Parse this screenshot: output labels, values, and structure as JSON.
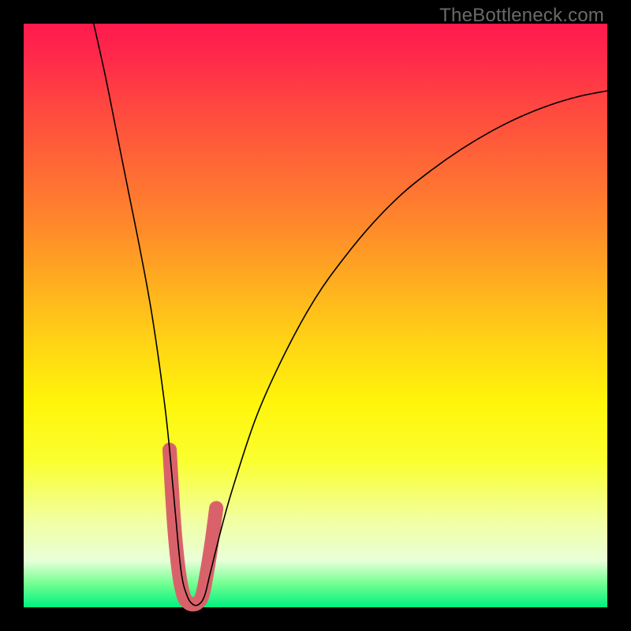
{
  "watermark": "TheBottleneck.com",
  "chart_data": {
    "type": "line",
    "title": "",
    "xlabel": "",
    "ylabel": "",
    "xlim": [
      0,
      100
    ],
    "ylim": [
      0,
      100
    ],
    "grid": false,
    "legend": false,
    "background_gradient": {
      "top": "#ff1a4d",
      "middle": "#fff50a",
      "bottom": "#00f080"
    },
    "series": [
      {
        "name": "bottleneck-curve",
        "color": "#000000",
        "width": 1.5,
        "x": [
          12,
          14,
          16,
          18,
          20,
          22,
          24,
          25,
          26,
          27,
          28,
          29,
          30,
          31,
          32,
          34,
          36,
          40,
          45,
          50,
          55,
          60,
          65,
          70,
          75,
          80,
          85,
          90,
          95,
          100
        ],
        "y": [
          100,
          91,
          81,
          71,
          61,
          50,
          36,
          27,
          16,
          6,
          2,
          0.5,
          0.5,
          2,
          6,
          14,
          21,
          33,
          44,
          53,
          60,
          66,
          71,
          75,
          78.5,
          81.5,
          84,
          86,
          87.5,
          88.5
        ]
      },
      {
        "name": "sweet-spot-overlay",
        "color": "#d9626a",
        "width": 10,
        "x": [
          25.0,
          25.8,
          26.6,
          27.4,
          28.2,
          29.0,
          29.8,
          30.6,
          31.4,
          32.2,
          33.0
        ],
        "y": [
          27,
          14,
          6,
          2,
          0.8,
          0.5,
          0.8,
          2,
          6,
          11,
          17
        ]
      }
    ]
  }
}
